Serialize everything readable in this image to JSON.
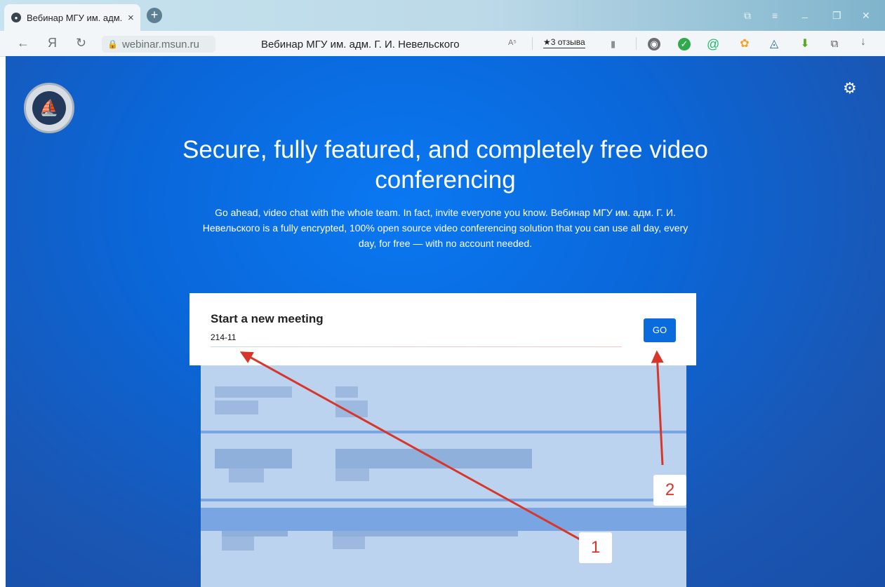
{
  "browser": {
    "tab_title": "Вебинар МГУ им. адм. I",
    "tab_close": "×",
    "new_tab": "+",
    "url": "webinar.msun.ru",
    "page_title": "Вебинар МГУ им. адм. Г. И. Невельского",
    "translate": "A⁵",
    "reviews": "★3 отзыва",
    "window_controls": [
      "⧉",
      "≡",
      "_",
      "❐",
      "✕"
    ],
    "nav_icons": [
      "back-icon",
      "yandex-icon",
      "reload-icon"
    ],
    "nav_glyphs": {
      "back": "←",
      "yandex": "Я",
      "reload": "↻",
      "download": "↓"
    },
    "extension_icons": [
      "ext-icon-1",
      "shield-icon",
      "at-icon",
      "paw-icon",
      "triangle-icon",
      "download-arrow-icon",
      "clipboard-icon"
    ]
  },
  "page": {
    "headline": "Secure, fully featured, and completely free video conferencing",
    "subtext": "Go ahead, video chat with the whole team. In fact, invite everyone you know. Вебинар МГУ им. адм. Г. И. Невельского is a fully encrypted, 100% open source video conferencing solution that you can use all day, every day, for free — with no account needed.",
    "meeting": {
      "label": "Start a new meeting",
      "value": "214-11",
      "go_label": "GO"
    }
  },
  "annotations": {
    "badge_1": "1",
    "badge_2": "2"
  },
  "colors": {
    "accent": "#0a6cdc",
    "annotation": "#d9362b",
    "page_bg": "#0a67d9"
  }
}
